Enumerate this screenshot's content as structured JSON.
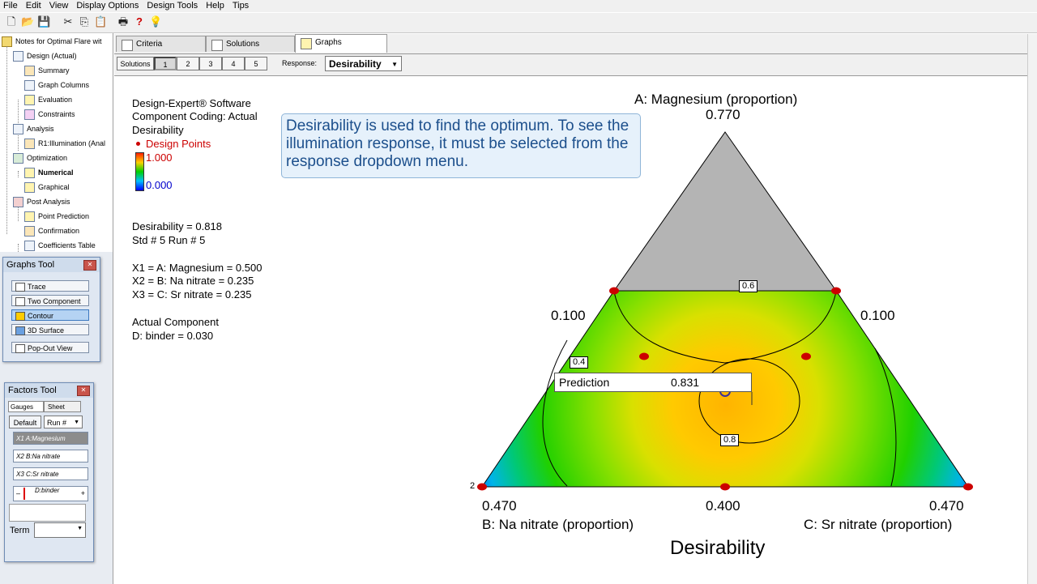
{
  "menu": [
    "File",
    "Edit",
    "View",
    "Display Options",
    "Design Tools",
    "Help",
    "Tips"
  ],
  "tree": {
    "root": "Notes for Optimal Flare wit",
    "items": [
      "Design (Actual)",
      "Summary",
      "Graph Columns",
      "Evaluation",
      "Constraints",
      "Analysis",
      "R1:Illumination (Anal",
      "Optimization",
      "Numerical",
      "Graphical",
      "Post Analysis",
      "Point Prediction",
      "Confirmation",
      "Coefficients Table"
    ]
  },
  "graphs_tool": {
    "title": "Graphs Tool",
    "buttons": [
      "Trace",
      "Two Component",
      "Contour",
      "3D Surface",
      "Pop-Out View"
    ]
  },
  "factors_tool": {
    "title": "Factors Tool",
    "tab_gauges": "Gauges",
    "tab_sheet": "Sheet",
    "default_label": "Default",
    "run_label": "Run #",
    "factors": [
      "X1 A:Magnesium",
      "X2 B:Na nitrate",
      "X3 C:Sr nitrate",
      "D:binder"
    ],
    "minus": "–",
    "plus": "+",
    "term_label": "Term"
  },
  "tabs": [
    "Criteria",
    "Solutions",
    "Graphs"
  ],
  "solutions": {
    "label": "Solutions",
    "buttons": [
      "1",
      "2",
      "3",
      "4",
      "5"
    ],
    "response_label": "Response:",
    "response_value": "Desirability"
  },
  "info": {
    "lines": [
      "Design-Expert® Software",
      "Component Coding: Actual",
      "Desirability"
    ],
    "design_points": "Design Points",
    "scale_high": "1.000",
    "scale_low": "0.000",
    "result_lines": [
      "Desirability = 0.818",
      "Std # 5 Run # 5"
    ],
    "factor_lines": [
      "X1 = A: Magnesium = 0.500",
      "X2 = B: Na nitrate = 0.235",
      "X3 = C: Sr nitrate = 0.235"
    ],
    "actual_lines": [
      "Actual Component",
      "D: binder = 0.030"
    ]
  },
  "callout": "Desirability is used to find the optimum.  To see the illumination response, it must be selected from the response dropdown menu.",
  "chart_data": {
    "type": "contour",
    "title": "Desirability",
    "axes": {
      "A": {
        "label": "A: Magnesium (proportion)",
        "max": "0.770",
        "min": "0.100"
      },
      "B": {
        "label": "B: Na nitrate (proportion)",
        "max": "0.470",
        "min": "0.100"
      },
      "C": {
        "label": "C: Sr nitrate (proportion)",
        "max": "0.470",
        "min": "0.400"
      }
    },
    "tick_labels": [
      "0.770",
      "0.100",
      "0.100",
      "0.470",
      "0.400",
      "0.470"
    ],
    "contour_labels": [
      "0.6",
      "0.4",
      "0.8"
    ],
    "point_count_label": "2",
    "prediction": {
      "label": "Prediction",
      "value": "0.831"
    },
    "colors": {
      "low": "#0000ff",
      "mid": "#00d000",
      "high": "#ff2000",
      "excluded": "#b4b4b4",
      "design_point": "#cc0000"
    }
  }
}
